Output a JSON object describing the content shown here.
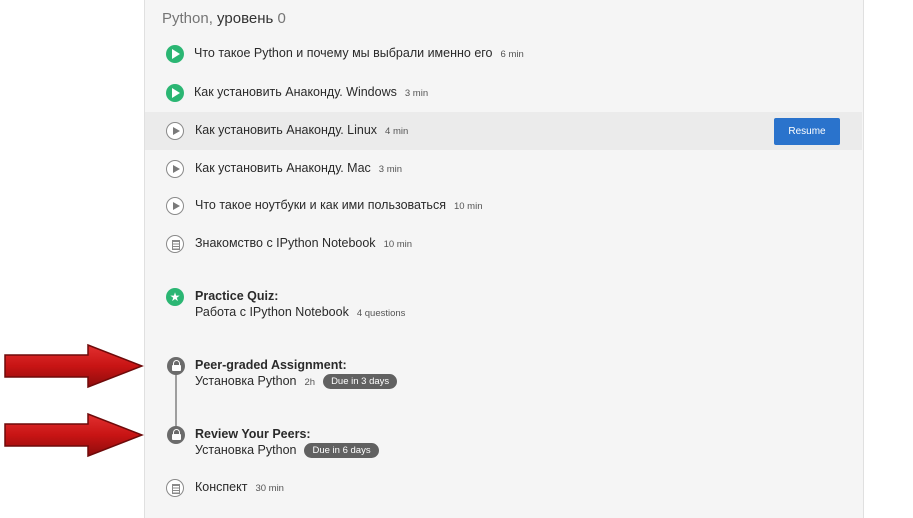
{
  "week": {
    "title_prefix": "Python, ",
    "title_bold": "уровень",
    "title_suffix": " 0"
  },
  "items": [
    {
      "title": "Что такое Python и почему мы выбрали именно его",
      "duration": "6 min"
    },
    {
      "title": "Как установить Анаконду. Windows",
      "duration": "3 min"
    },
    {
      "title": "Как установить Анаконду. Linux",
      "duration": "4 min"
    },
    {
      "title": "Как установить Анаконду. Mac",
      "duration": "3 min"
    },
    {
      "title": "Что такое ноутбуки и как ими пользоваться",
      "duration": "10 min"
    },
    {
      "title": "Знакомство с IPython Notebook",
      "duration": "10 min"
    }
  ],
  "resume_label": "Resume",
  "quiz": {
    "label": "Practice Quiz:",
    "title": "Работа с IPython Notebook",
    "meta": "4 questions"
  },
  "assignment": {
    "label": "Peer-graded Assignment:",
    "title": "Установка Python",
    "meta": "2h",
    "due": "Due in 3 days"
  },
  "review": {
    "label": "Review Your Peers:",
    "title": "Установка Python",
    "due": "Due in 6 days"
  },
  "notes": {
    "title": "Конспект",
    "duration": "30 min"
  },
  "icons": {
    "done": "play-circle-filled-icon",
    "play": "play-circle-outline-icon",
    "reading": "document-icon",
    "quiz": "star-icon",
    "locked": "lock-icon",
    "arrow": "red-arrow-right-icon"
  },
  "colors": {
    "done_green": "#2bb673",
    "resume_blue": "#2a73cc",
    "arrow_red": "#c81414",
    "badge_gray": "#616161"
  }
}
